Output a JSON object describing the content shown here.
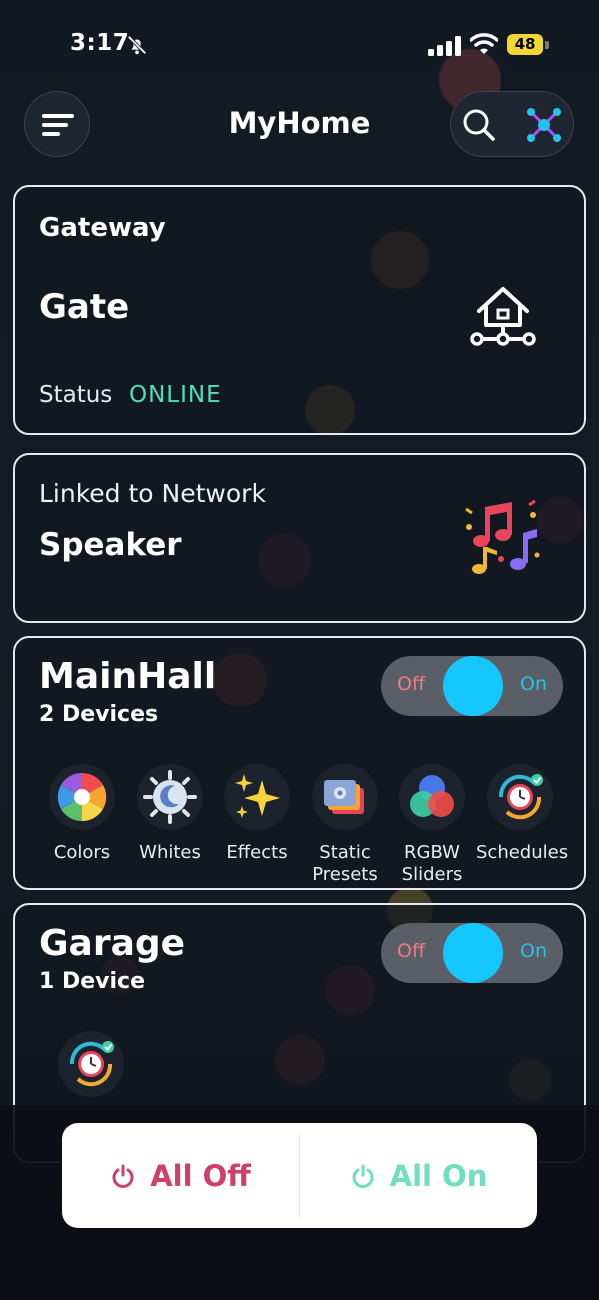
{
  "status_bar": {
    "time": "3:17",
    "battery": "48"
  },
  "header": {
    "title": "MyHome"
  },
  "gateway": {
    "label": "Gateway",
    "name": "Gate",
    "status_label": "Status",
    "status_value": "ONLINE"
  },
  "speaker": {
    "label": "Linked to Network",
    "name": "Speaker"
  },
  "rooms": [
    {
      "name": "MainHall",
      "devices": "2 Devices",
      "toggle": {
        "off": "Off",
        "on": "On",
        "state": "on"
      },
      "features": [
        {
          "icon": "color-wheel-icon",
          "label": "Colors"
        },
        {
          "icon": "sun-moon-icon",
          "label": "Whites"
        },
        {
          "icon": "sparkles-icon",
          "label": "Effects"
        },
        {
          "icon": "presets-icon",
          "label": "Static\nPresets"
        },
        {
          "icon": "rgb-circles-icon",
          "label": "RGBW\nSliders"
        },
        {
          "icon": "clock-check-icon",
          "label": "Schedules"
        }
      ]
    },
    {
      "name": "Garage",
      "devices": "1 Device",
      "toggle": {
        "off": "Off",
        "on": "On",
        "state": "on"
      },
      "features": [
        {
          "icon": "clock-check-icon",
          "label": ""
        }
      ]
    }
  ],
  "bottom": {
    "all_off": "All Off",
    "all_on": "All On"
  },
  "colors": {
    "online": "#4fe0b7",
    "toggle_knob": "#16c7ff",
    "all_off": "#cf3f6c",
    "all_on": "#6fdfc0"
  }
}
